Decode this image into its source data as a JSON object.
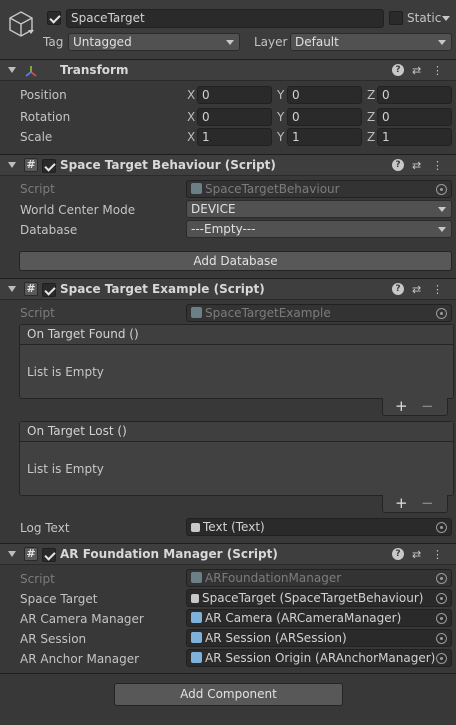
{
  "gameobject": {
    "name": "SpaceTarget",
    "active": true,
    "static_label": "Static",
    "tag_label": "Tag",
    "tag_value": "Untagged",
    "layer_label": "Layer",
    "layer_value": "Default"
  },
  "transform": {
    "title": "Transform",
    "rows": [
      {
        "label": "Position",
        "x": "0",
        "y": "0",
        "z": "0"
      },
      {
        "label": "Rotation",
        "x": "0",
        "y": "0",
        "z": "0"
      },
      {
        "label": "Scale",
        "x": "1",
        "y": "1",
        "z": "1"
      }
    ],
    "axis": {
      "x": "X",
      "y": "Y",
      "z": "Z"
    }
  },
  "behaviour": {
    "title": "Space Target Behaviour (Script)",
    "script_label": "Script",
    "script_value": "SpaceTargetBehaviour",
    "mode_label": "World Center Mode",
    "mode_value": "DEVICE",
    "db_label": "Database",
    "db_value": "---Empty---",
    "add_db": "Add Database"
  },
  "example": {
    "title": "Space Target Example (Script)",
    "script_label": "Script",
    "script_value": "SpaceTargetExample",
    "found_title": "On Target Found ()",
    "found_empty": "List is Empty",
    "lost_title": "On Target Lost ()",
    "lost_empty": "List is Empty",
    "log_label": "Log Text",
    "log_value": "Text (Text)",
    "plus": "+",
    "minus": "−"
  },
  "arfm": {
    "title": "AR Foundation Manager (Script)",
    "script_label": "Script",
    "script_value": "ARFoundationManager",
    "rows": [
      {
        "label": "Space Target",
        "value": "SpaceTarget (SpaceTargetBehaviour)"
      },
      {
        "label": "AR Camera Manager",
        "value": "AR Camera (ARCameraManager)"
      },
      {
        "label": "AR Session",
        "value": "AR Session (ARSession)"
      },
      {
        "label": "AR Anchor Manager",
        "value": "AR Session Origin (ARAnchorManager)"
      }
    ]
  },
  "add_component": "Add Component"
}
